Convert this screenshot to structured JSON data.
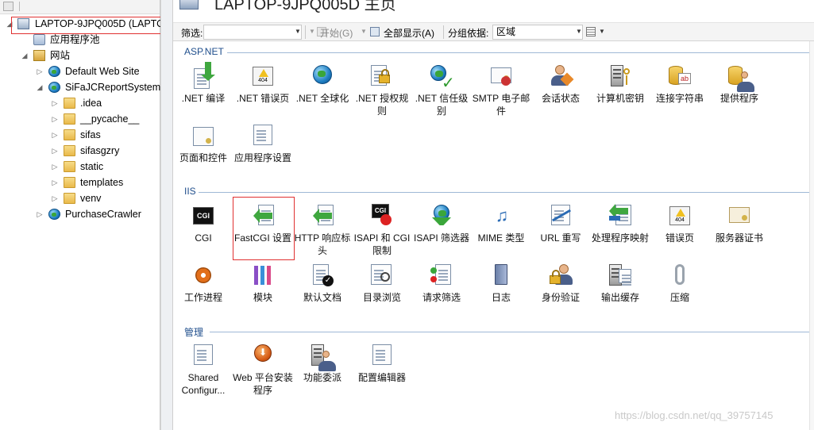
{
  "tree": {
    "items": [
      {
        "label": "LAPTOP-9JPQ005D (LAPTO",
        "icon": "server-icon"
      },
      {
        "label": "应用程序池",
        "icon": "app-pool-icon"
      },
      {
        "label": "网站",
        "icon": "sites-icon"
      },
      {
        "label": "Default Web Site",
        "icon": "globe-icon"
      },
      {
        "label": "SiFaJCReportSystem",
        "icon": "globe-icon"
      },
      {
        "label": ".idea",
        "icon": "folder-icon"
      },
      {
        "label": "__pycache__",
        "icon": "folder-icon"
      },
      {
        "label": "sifas",
        "icon": "folder-icon"
      },
      {
        "label": "sifasgzry",
        "icon": "folder-icon"
      },
      {
        "label": "static",
        "icon": "folder-icon"
      },
      {
        "label": "templates",
        "icon": "folder-icon"
      },
      {
        "label": "venv",
        "icon": "folder-icon"
      },
      {
        "label": "PurchaseCrawler",
        "icon": "globe-icon"
      }
    ]
  },
  "header": {
    "title": "LAPTOP-9JPQ005D 主页"
  },
  "filter_bar": {
    "filter_label": "筛选:",
    "start_label": "开始(G)",
    "show_all_label": "全部显示(A)",
    "group_by_label": "分组依据:",
    "group_by_value": "区域"
  },
  "sections": {
    "aspnet": {
      "title": "ASP.NET",
      "features": [
        {
          "label": ".NET 编译",
          "icon": "dotnet-compile-icon"
        },
        {
          "label": ".NET 错误页",
          "icon": "dotnet-error-page-icon"
        },
        {
          "label": ".NET 全球化",
          "icon": "globalization-icon"
        },
        {
          "label": ".NET 授权规则",
          "icon": "authorization-rules-icon"
        },
        {
          "label": ".NET 信任级别",
          "icon": "trust-levels-icon"
        },
        {
          "label": "SMTP 电子邮件",
          "icon": "smtp-email-icon"
        },
        {
          "label": "会话状态",
          "icon": "session-state-icon"
        },
        {
          "label": "计算机密钥",
          "icon": "machine-key-icon"
        },
        {
          "label": "连接字符串",
          "icon": "connection-strings-icon"
        },
        {
          "label": "提供程序",
          "icon": "providers-icon"
        },
        {
          "label": "页面和控件",
          "icon": "pages-controls-icon"
        },
        {
          "label": "应用程序设置",
          "icon": "app-settings-icon"
        }
      ]
    },
    "iis": {
      "title": "IIS",
      "features": [
        {
          "label": "CGI",
          "icon": "cgi-icon"
        },
        {
          "label": "FastCGI 设置",
          "icon": "fastcgi-settings-icon"
        },
        {
          "label": "HTTP 响应标头",
          "icon": "http-response-headers-icon"
        },
        {
          "label": "ISAPI 和 CGI 限制",
          "icon": "isapi-cgi-restrictions-icon"
        },
        {
          "label": "ISAPI 筛选器",
          "icon": "isapi-filters-icon"
        },
        {
          "label": "MIME 类型",
          "icon": "mime-types-icon"
        },
        {
          "label": "URL 重写",
          "icon": "url-rewrite-icon"
        },
        {
          "label": "处理程序映射",
          "icon": "handler-mappings-icon"
        },
        {
          "label": "错误页",
          "icon": "error-pages-icon"
        },
        {
          "label": "服务器证书",
          "icon": "server-certificates-icon"
        },
        {
          "label": "工作进程",
          "icon": "worker-processes-icon"
        },
        {
          "label": "模块",
          "icon": "modules-icon"
        },
        {
          "label": "默认文档",
          "icon": "default-document-icon"
        },
        {
          "label": "目录浏览",
          "icon": "directory-browsing-icon"
        },
        {
          "label": "请求筛选",
          "icon": "request-filtering-icon"
        },
        {
          "label": "日志",
          "icon": "logging-icon"
        },
        {
          "label": "身份验证",
          "icon": "authentication-icon"
        },
        {
          "label": "输出缓存",
          "icon": "output-caching-icon"
        },
        {
          "label": "压缩",
          "icon": "compression-icon"
        }
      ]
    },
    "management": {
      "title": "管理",
      "features": [
        {
          "label": "Shared Configur...",
          "icon": "shared-configuration-icon"
        },
        {
          "label": "Web 平台安装程序",
          "icon": "web-platform-installer-icon"
        },
        {
          "label": "功能委派",
          "icon": "feature-delegation-icon"
        },
        {
          "label": "配置编辑器",
          "icon": "configuration-editor-icon"
        }
      ]
    }
  },
  "watermark": "https://blog.csdn.net/qq_39757145",
  "colors": {
    "section_title": "#1f4e8c",
    "highlight_box": "#e03030"
  }
}
